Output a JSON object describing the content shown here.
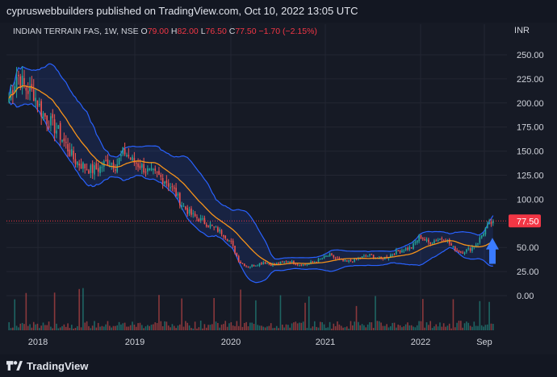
{
  "publish": {
    "author": "cypruswebbuilders",
    "text": "published on TradingView.com, Oct 10, 2022 13:05 UTC"
  },
  "legend": {
    "symbol": "INDIAN TERRAIN FAS, 1W, NSE",
    "o_label": "O",
    "o_value": "79.00",
    "h_label": "H",
    "h_value": "82.00",
    "l_label": "L",
    "l_value": "76.50",
    "c_label": "C",
    "c_value": "77.50",
    "change": "−1.70 (−2.15%)"
  },
  "axis_unit": "INR",
  "last_price_label": "77.50",
  "footer": {
    "brand": "TradingView"
  },
  "colors": {
    "up": "#26a69a",
    "down": "#ef5350",
    "sma": "#f7931a",
    "band": "#2962ff",
    "band_fill": "#2962ff22",
    "arrow": "#3a7bff",
    "price_tag": "#f23645"
  },
  "chart_data": {
    "type": "candlestick",
    "ylim": [
      -10,
      265
    ],
    "y_ticks": [
      0,
      25,
      50,
      75,
      100,
      125,
      150,
      175,
      200,
      225,
      250
    ],
    "y_tick_labels": [
      "0.00",
      "25.00",
      "50.00",
      "75.00",
      "100.00",
      "125.00",
      "150.00",
      "175.00",
      "200.00",
      "225.00",
      "250.00"
    ],
    "x_tick_labels": [
      "2018",
      "2019",
      "2020",
      "2021",
      "2022",
      "Sep"
    ],
    "last_price": 77.5,
    "price_path": [
      [
        "2017-11",
        205
      ],
      [
        "2017-12",
        230
      ],
      [
        "2018-01",
        215
      ],
      [
        "2018-02",
        210
      ],
      [
        "2018-03",
        190
      ],
      [
        "2018-04",
        180
      ],
      [
        "2018-05",
        170
      ],
      [
        "2018-06",
        155
      ],
      [
        "2018-07",
        140
      ],
      [
        "2018-08",
        135
      ],
      [
        "2018-09",
        130
      ],
      [
        "2018-10",
        132
      ],
      [
        "2018-11",
        140
      ],
      [
        "2018-12",
        135
      ],
      [
        "2019-01",
        150
      ],
      [
        "2019-02",
        140
      ],
      [
        "2019-03",
        135
      ],
      [
        "2019-04",
        128
      ],
      [
        "2019-05",
        125
      ],
      [
        "2019-06",
        120
      ],
      [
        "2019-07",
        110
      ],
      [
        "2019-08",
        95
      ],
      [
        "2019-09",
        85
      ],
      [
        "2019-10",
        80
      ],
      [
        "2019-11",
        75
      ],
      [
        "2019-12",
        70
      ],
      [
        "2020-01",
        65
      ],
      [
        "2020-02",
        55
      ],
      [
        "2020-03",
        35
      ],
      [
        "2020-04",
        30
      ],
      [
        "2020-05",
        32
      ],
      [
        "2020-06",
        35
      ],
      [
        "2020-07",
        32
      ],
      [
        "2020-08",
        34
      ],
      [
        "2020-09",
        36
      ],
      [
        "2020-10",
        33
      ],
      [
        "2020-11",
        32
      ],
      [
        "2020-12",
        35
      ],
      [
        "2021-01",
        38
      ],
      [
        "2021-02",
        42
      ],
      [
        "2021-03",
        38
      ],
      [
        "2021-04",
        35
      ],
      [
        "2021-05",
        37
      ],
      [
        "2021-06",
        40
      ],
      [
        "2021-07",
        42
      ],
      [
        "2021-08",
        38
      ],
      [
        "2021-09",
        40
      ],
      [
        "2021-10",
        45
      ],
      [
        "2021-11",
        48
      ],
      [
        "2021-12",
        50
      ],
      [
        "2022-01",
        62
      ],
      [
        "2022-02",
        55
      ],
      [
        "2022-03",
        58
      ],
      [
        "2022-04",
        60
      ],
      [
        "2022-05",
        50
      ],
      [
        "2022-06",
        45
      ],
      [
        "2022-07",
        48
      ],
      [
        "2022-08",
        55
      ],
      [
        "2022-09",
        70
      ],
      [
        "2022-10",
        77.5
      ]
    ]
  }
}
